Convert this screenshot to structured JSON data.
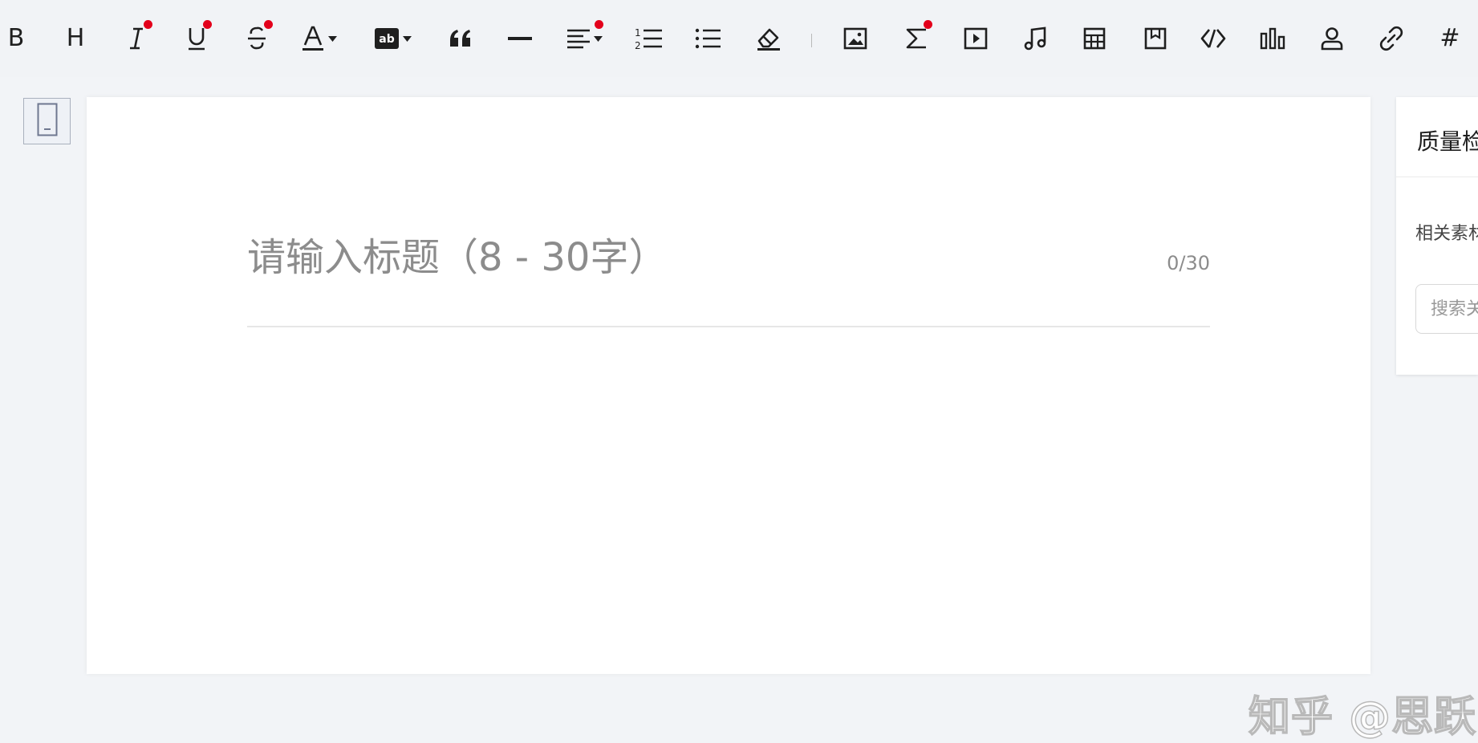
{
  "toolbar": {
    "bold": "B",
    "heading": "H",
    "hashtag": "#"
  },
  "editor": {
    "title_placeholder": "请输入标题（8 - 30字）",
    "title_counter": "0/30",
    "watermark": "知乎 @思跃喵"
  },
  "side_panel": {
    "title": "质量检",
    "related_label": "相关素材",
    "search_placeholder": "搜索关"
  }
}
